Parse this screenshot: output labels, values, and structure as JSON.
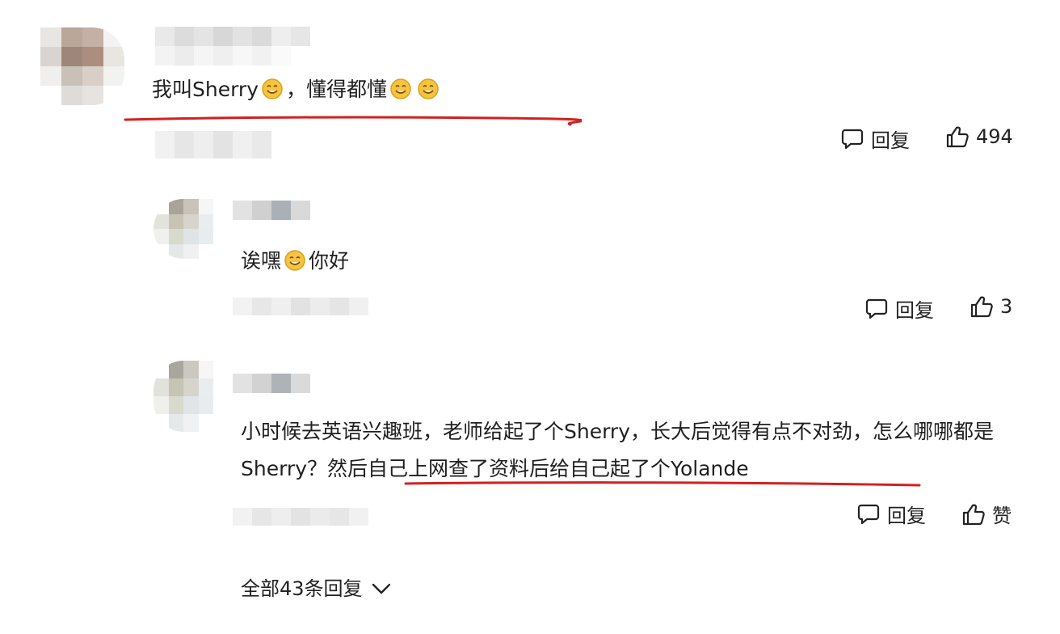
{
  "comments": [
    {
      "text_before": "我叫Sherry",
      "text_middle": "，懂得都懂",
      "reply_label": "回复",
      "like_count": "494",
      "icons": [
        "grin-emoji-icon",
        "comment-icon",
        "thumbs-up-icon"
      ]
    },
    {
      "text_before": "诶嘿",
      "text_after": "你好",
      "reply_label": "回复",
      "like_count": "3",
      "icons": [
        "grin-emoji-icon",
        "comment-icon",
        "thumbs-up-icon"
      ]
    },
    {
      "text_part1": "小时候去英语兴趣班，老师给起了个Sherry，长大后觉得有点不对劲，怎么哪哪都是Sherry？",
      "text_part2": "然后自己上网查了资料后给自己起了个Yolande",
      "reply_label": "回复",
      "like_label": "赞",
      "icons": [
        "comment-icon",
        "thumbs-up-icon"
      ]
    }
  ],
  "more_replies": "全部43条回复",
  "colors": {
    "underline": "#d32020",
    "emoji_face": "#f5c342",
    "emoji_outline": "#d9a21c"
  }
}
